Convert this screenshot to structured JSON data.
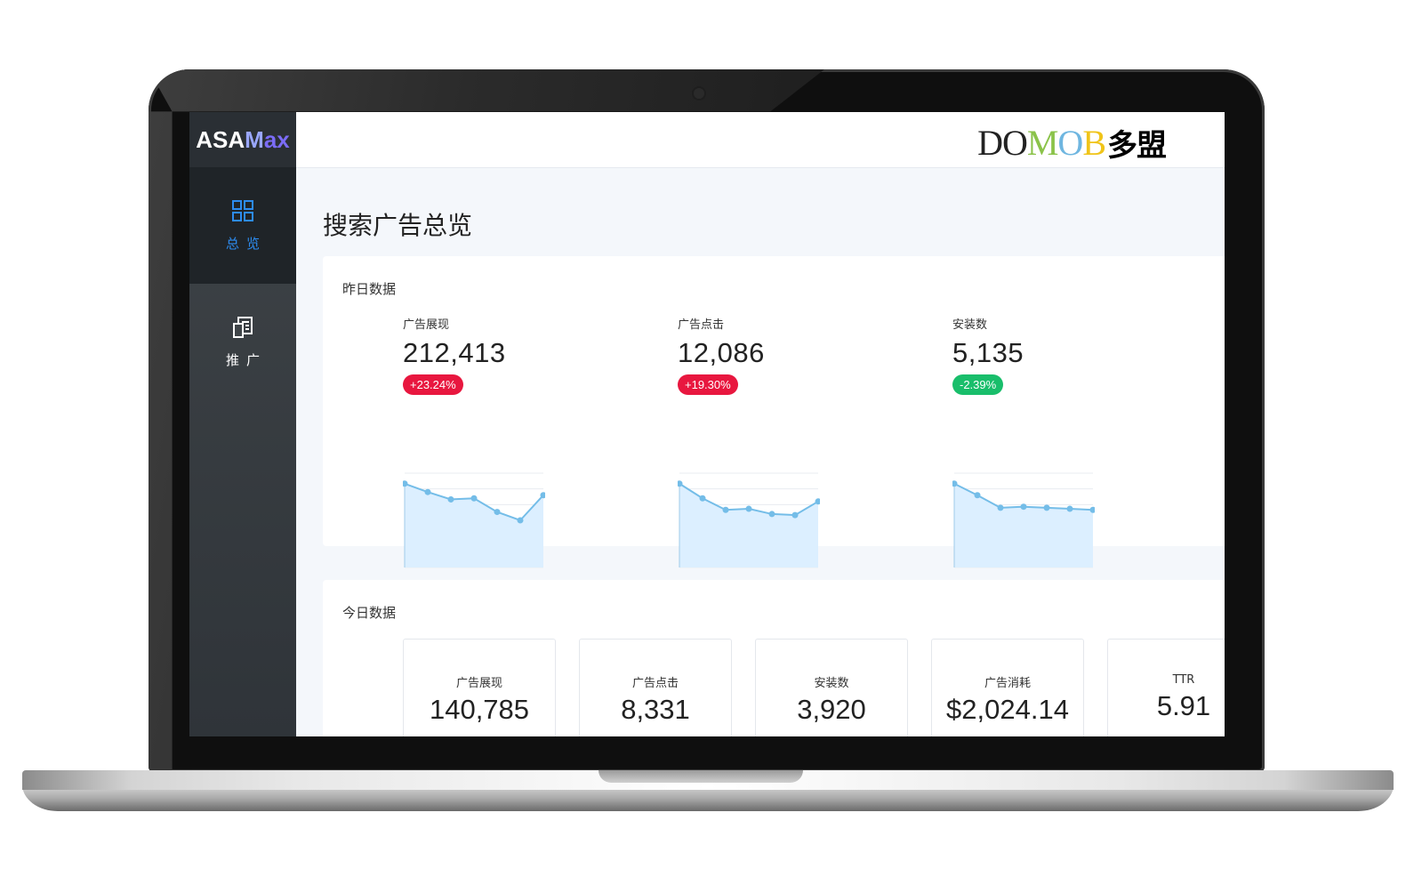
{
  "app": {
    "logo_primary": "ASA",
    "logo_accent": "ax",
    "logo_mark": "M"
  },
  "sidebar": {
    "items": [
      {
        "label": "总览",
        "icon": "grid-icon",
        "active": true
      },
      {
        "label": "推广",
        "icon": "document-icon",
        "active": false
      }
    ]
  },
  "header": {
    "brand_letters": [
      {
        "ch": "D",
        "color": "#222222"
      },
      {
        "ch": "O",
        "color": "#222222"
      },
      {
        "ch": "M",
        "color": "#8bc34a"
      },
      {
        "ch": "O",
        "color": "#6fb6e0"
      },
      {
        "ch": "B",
        "color": "#f0c419"
      }
    ],
    "brand_cn": "多盟"
  },
  "page": {
    "title": "搜索广告总览"
  },
  "yesterday": {
    "title": "昨日数据",
    "metrics": [
      {
        "label": "广告展现",
        "value": "212,413",
        "change": "+23.24%",
        "trend": "up",
        "series": [
          8,
          7.2,
          6.5,
          6.6,
          5.3,
          4.5,
          6.9
        ]
      },
      {
        "label": "广告点击",
        "value": "12,086",
        "change": "+19.30%",
        "trend": "up",
        "series": [
          8,
          6.6,
          5.5,
          5.6,
          5.1,
          5.0,
          6.3
        ]
      },
      {
        "label": "安装数",
        "value": "5,135",
        "change": "-2.39%",
        "trend": "down",
        "series": [
          8,
          6.9,
          5.7,
          5.8,
          5.7,
          5.6,
          5.5
        ]
      }
    ]
  },
  "today": {
    "title": "今日数据",
    "stats": [
      {
        "label": "广告展现",
        "value": "140,785"
      },
      {
        "label": "广告点击",
        "value": "8,331"
      },
      {
        "label": "安装数",
        "value": "3,920"
      },
      {
        "label": "广告消耗",
        "value": "$2,024.14"
      },
      {
        "label": "TTR",
        "value": "5.91"
      }
    ]
  },
  "colors": {
    "accent": "#2d8cf0",
    "badge_up": "#e8173f",
    "badge_down": "#19be6b",
    "spark_line": "#74bde8",
    "spark_fill": "#dcefff"
  }
}
